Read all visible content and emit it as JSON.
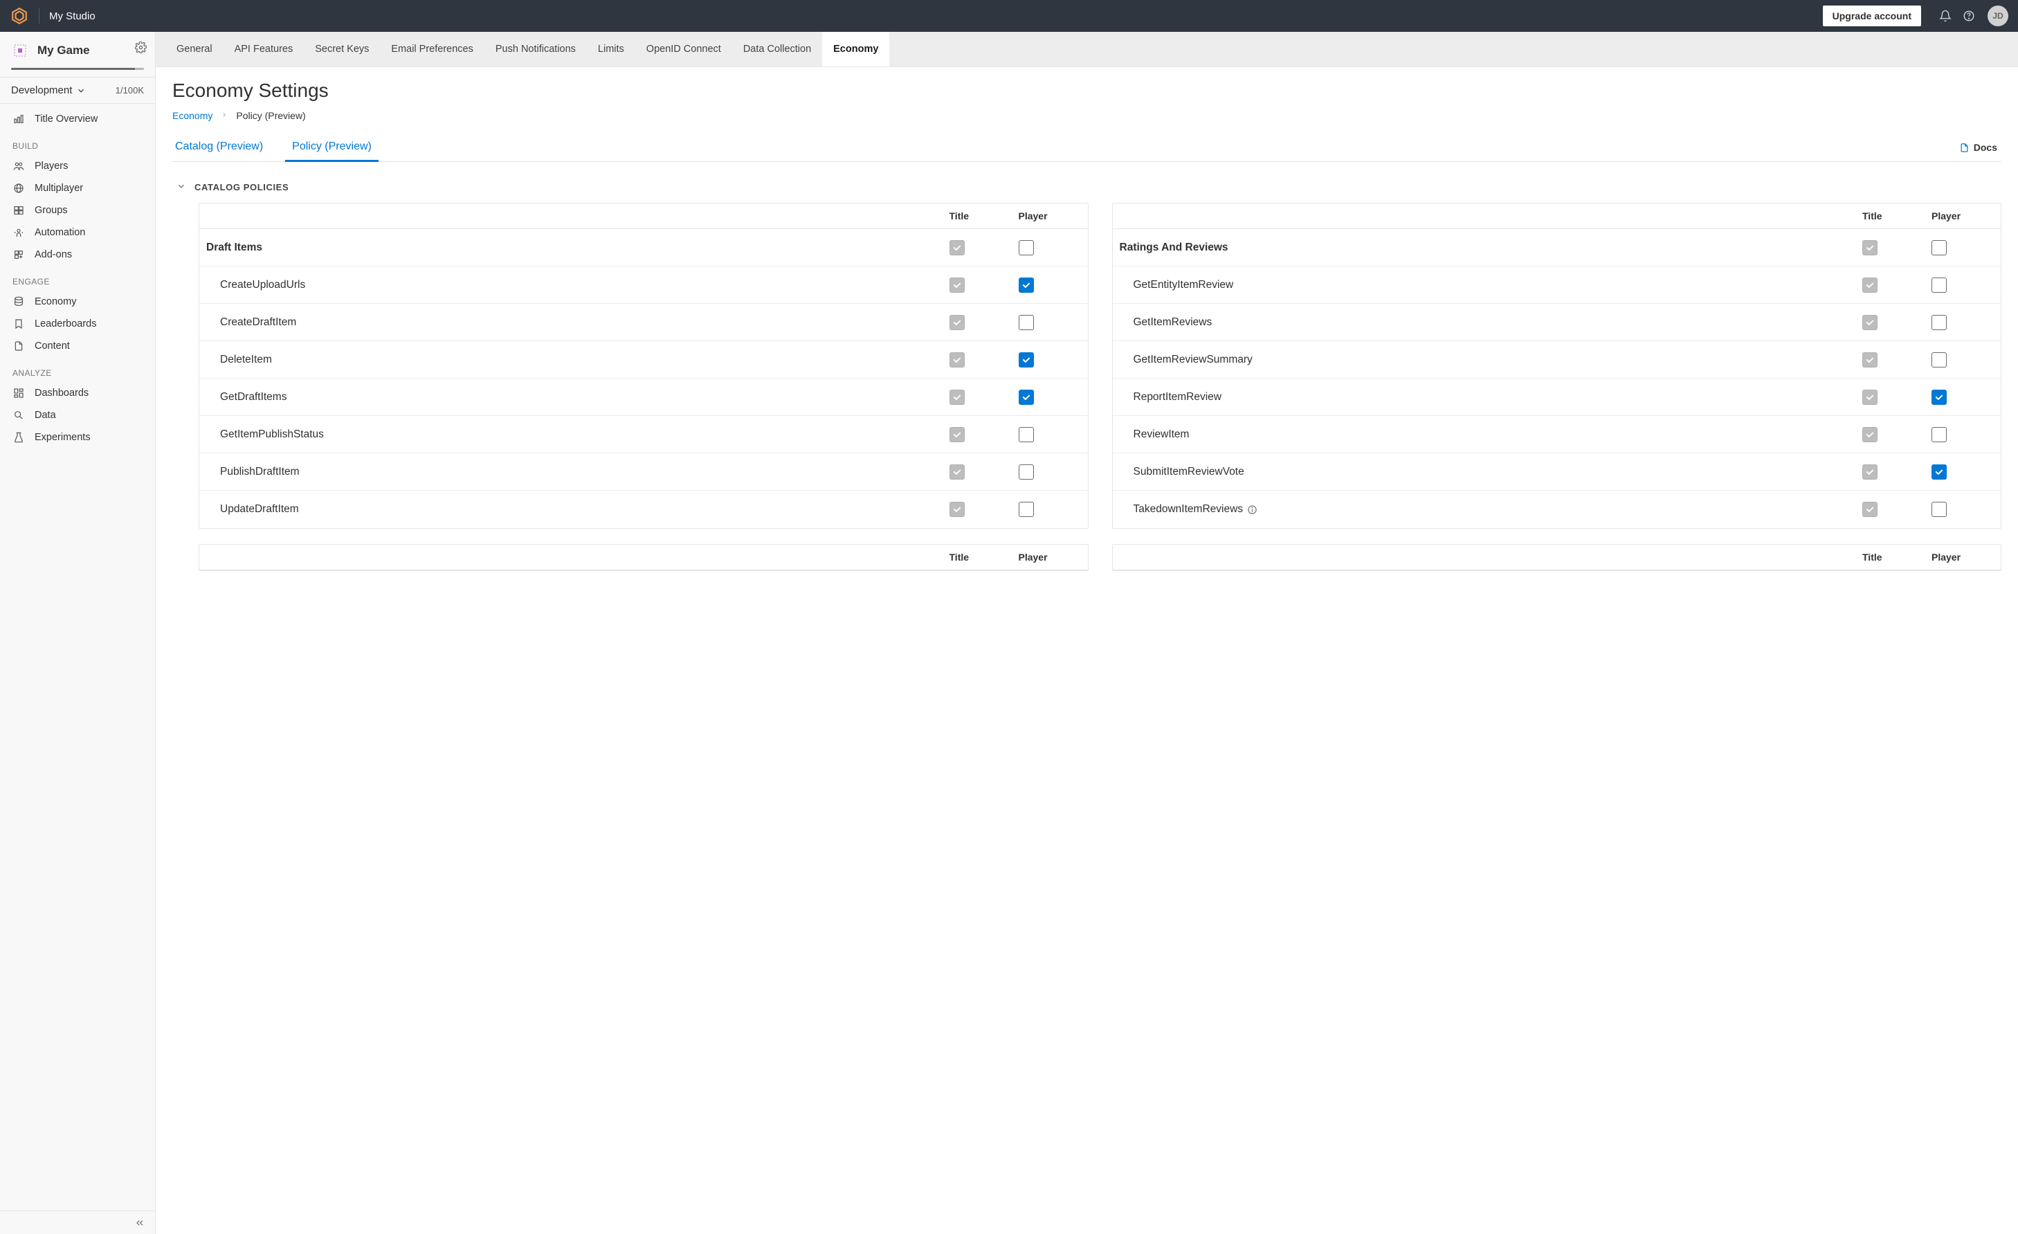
{
  "topbar": {
    "studio_name": "My Studio",
    "upgrade_label": "Upgrade account",
    "avatar_initials": "JD"
  },
  "sidebar": {
    "game_name": "My Game",
    "env_label": "Development",
    "count_label": "1/100K",
    "items": [
      {
        "icon": "bar-chart",
        "label": "Title Overview"
      }
    ],
    "sections": [
      {
        "header": "BUILD",
        "items": [
          {
            "icon": "users",
            "label": "Players"
          },
          {
            "icon": "globe",
            "label": "Multiplayer"
          },
          {
            "icon": "groups",
            "label": "Groups"
          },
          {
            "icon": "automation",
            "label": "Automation"
          },
          {
            "icon": "addons",
            "label": "Add-ons"
          }
        ]
      },
      {
        "header": "ENGAGE",
        "items": [
          {
            "icon": "database",
            "label": "Economy"
          },
          {
            "icon": "bookmark",
            "label": "Leaderboards"
          },
          {
            "icon": "file",
            "label": "Content"
          }
        ]
      },
      {
        "header": "ANALYZE",
        "items": [
          {
            "icon": "dashboard",
            "label": "Dashboards"
          },
          {
            "icon": "search",
            "label": "Data"
          },
          {
            "icon": "beaker",
            "label": "Experiments"
          }
        ]
      }
    ]
  },
  "settings_tabs": [
    "General",
    "API Features",
    "Secret Keys",
    "Email Preferences",
    "Push Notifications",
    "Limits",
    "OpenID Connect",
    "Data Collection",
    "Economy"
  ],
  "settings_tabs_active": "Economy",
  "page": {
    "title": "Economy Settings",
    "breadcrumb_root": "Economy",
    "breadcrumb_current": "Policy (Preview)",
    "docs_label": "Docs"
  },
  "subtabs": [
    "Catalog (Preview)",
    "Policy (Preview)"
  ],
  "subtabs_active": "Policy (Preview)",
  "catalog_section_label": "CATALOG POLICIES",
  "headers": {
    "title": "Title",
    "player": "Player"
  },
  "left_table": {
    "group": "Draft Items",
    "group_player_checked": false,
    "rows": [
      {
        "name": "CreateUploadUrls",
        "player": true
      },
      {
        "name": "CreateDraftItem",
        "player": false
      },
      {
        "name": "DeleteItem",
        "player": true
      },
      {
        "name": "GetDraftItems",
        "player": true
      },
      {
        "name": "GetItemPublishStatus",
        "player": false
      },
      {
        "name": "PublishDraftItem",
        "player": false
      },
      {
        "name": "UpdateDraftItem",
        "player": false
      }
    ]
  },
  "right_table": {
    "group": "Ratings And Reviews",
    "group_player_checked": false,
    "rows": [
      {
        "name": "GetEntityItemReview",
        "player": false
      },
      {
        "name": "GetItemReviews",
        "player": false
      },
      {
        "name": "GetItemReviewSummary",
        "player": false
      },
      {
        "name": "ReportItemReview",
        "player": true
      },
      {
        "name": "ReviewItem",
        "player": false
      },
      {
        "name": "SubmitItemReviewVote",
        "player": true
      },
      {
        "name": "TakedownItemReviews",
        "player": false,
        "info": true
      }
    ]
  }
}
